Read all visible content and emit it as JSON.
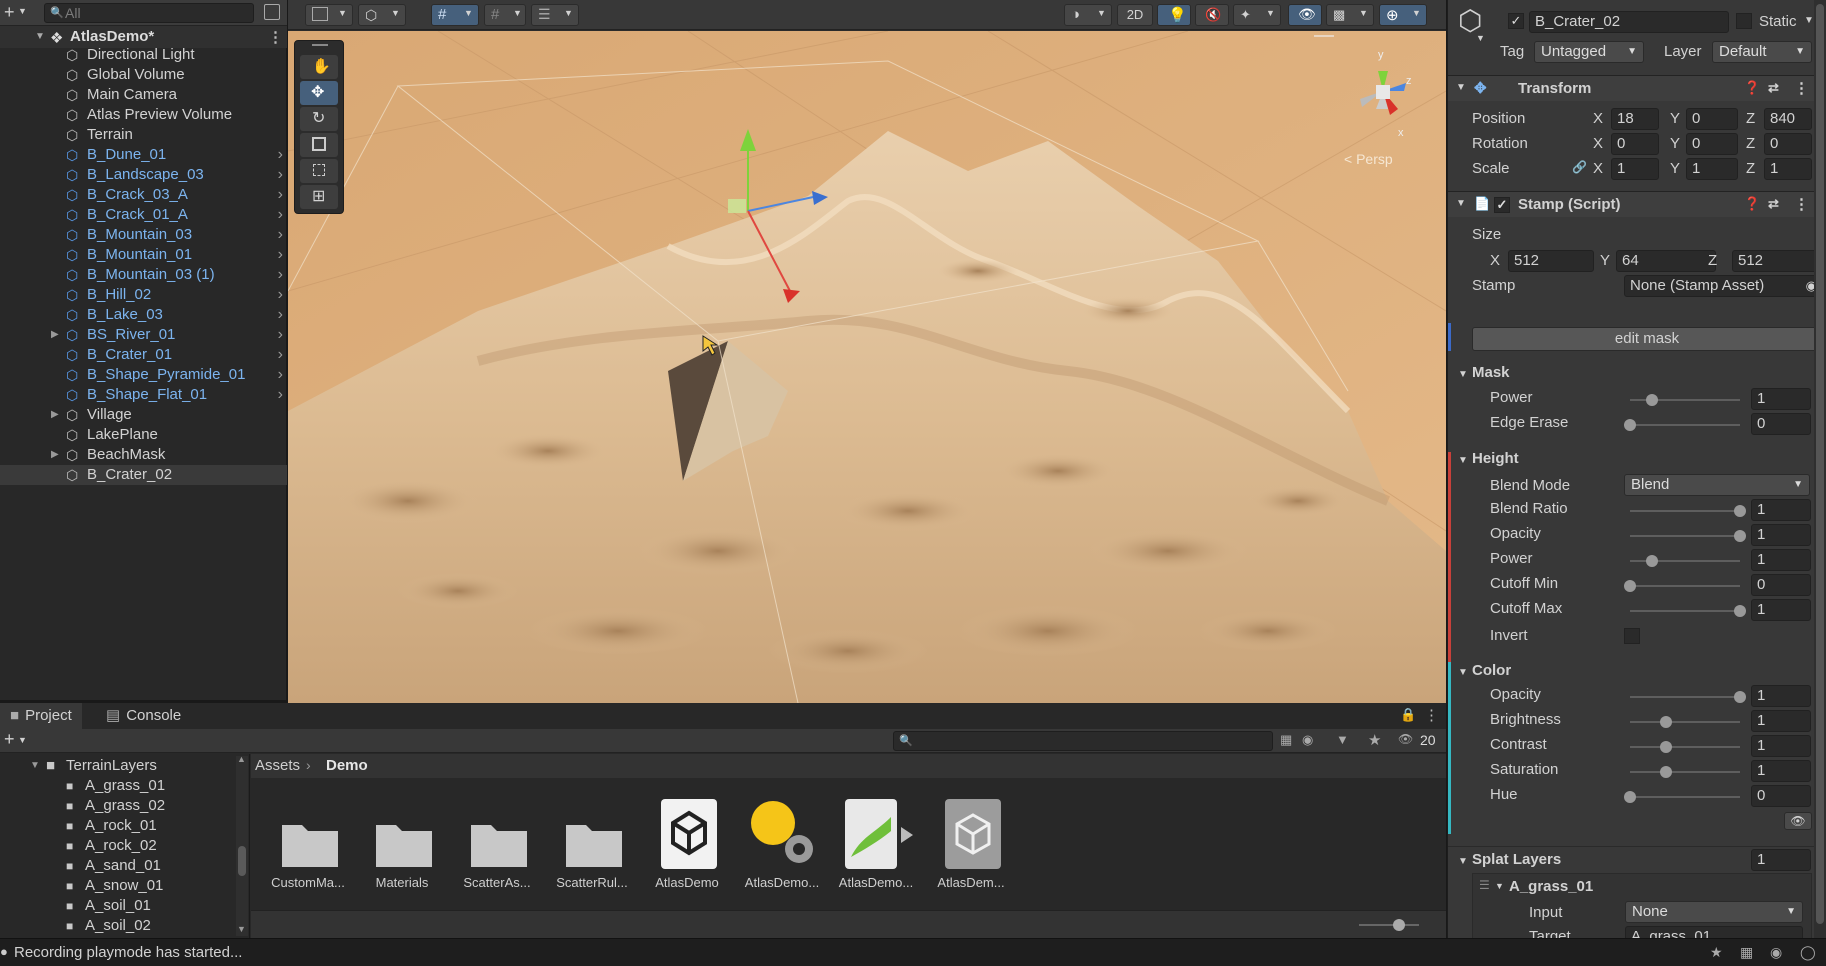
{
  "hierarchy": {
    "search_placeholder": "All",
    "scene_name": "AtlasDemo*",
    "items": [
      {
        "label": "Directional Light",
        "prefab": false,
        "expandable": false
      },
      {
        "label": "Global Volume",
        "prefab": false,
        "expandable": false
      },
      {
        "label": "Main Camera",
        "prefab": false,
        "expandable": false
      },
      {
        "label": "Atlas Preview Volume",
        "prefab": false,
        "expandable": false
      },
      {
        "label": "Terrain",
        "prefab": false,
        "expandable": false
      },
      {
        "label": "B_Dune_01",
        "prefab": true,
        "expandable": false
      },
      {
        "label": "B_Landscape_03",
        "prefab": true,
        "expandable": false
      },
      {
        "label": "B_Crack_03_A",
        "prefab": true,
        "expandable": false
      },
      {
        "label": "B_Crack_01_A",
        "prefab": true,
        "expandable": false
      },
      {
        "label": "B_Mountain_03",
        "prefab": true,
        "expandable": false
      },
      {
        "label": "B_Mountain_01",
        "prefab": true,
        "expandable": false
      },
      {
        "label": "B_Mountain_03 (1)",
        "prefab": true,
        "expandable": false
      },
      {
        "label": "B_Hill_02",
        "prefab": true,
        "expandable": false
      },
      {
        "label": "B_Lake_03",
        "prefab": true,
        "expandable": false
      },
      {
        "label": "BS_River_01",
        "prefab": true,
        "expandable": true
      },
      {
        "label": "B_Crater_01",
        "prefab": true,
        "expandable": false
      },
      {
        "label": "B_Shape_Pyramide_01",
        "prefab": true,
        "expandable": false
      },
      {
        "label": "B_Shape_Flat_01",
        "prefab": true,
        "expandable": false
      },
      {
        "label": "Village",
        "prefab": false,
        "expandable": true
      },
      {
        "label": "LakePlane",
        "prefab": false,
        "expandable": false
      },
      {
        "label": "BeachMask",
        "prefab": false,
        "expandable": true
      },
      {
        "label": "B_Crater_02",
        "prefab": false,
        "expandable": false,
        "selected": true
      }
    ]
  },
  "scene": {
    "toolbar": {
      "mode_2d": "2D"
    },
    "gizmo": {
      "persp_label": "< Persp",
      "axis_x": "x",
      "axis_y": "y",
      "axis_z": "z"
    }
  },
  "inspector": {
    "object_name": "B_Crater_02",
    "static_label": "Static",
    "tag_label": "Tag",
    "tag_value": "Untagged",
    "layer_label": "Layer",
    "layer_value": "Default",
    "transform": {
      "title": "Transform",
      "position_label": "Position",
      "rotation_label": "Rotation",
      "scale_label": "Scale",
      "position": {
        "x": "18",
        "y": "0",
        "z": "840"
      },
      "rotation": {
        "x": "0",
        "y": "0",
        "z": "0"
      },
      "scale": {
        "x": "1",
        "y": "1",
        "z": "1"
      }
    },
    "stamp": {
      "title": "Stamp (Script)",
      "size_label": "Size",
      "size": {
        "x": "512",
        "y": "64",
        "z": "512"
      },
      "stamp_label": "Stamp",
      "stamp_value": "None (Stamp Asset)",
      "edit_mask_label": "edit mask"
    },
    "mask": {
      "title": "Mask",
      "power_label": "Power",
      "power_value": "1",
      "power_level": 0.2,
      "edge_erase_label": "Edge Erase",
      "edge_erase_value": "0",
      "edge_erase_level": 0.0
    },
    "height": {
      "title": "Height",
      "blend_mode_label": "Blend Mode",
      "blend_mode_value": "Blend",
      "blend_ratio_label": "Blend Ratio",
      "blend_ratio_value": "1",
      "blend_ratio_level": 1.0,
      "opacity_label": "Opacity",
      "opacity_value": "1",
      "opacity_level": 1.0,
      "power_label": "Power",
      "power_value": "1",
      "power_level": 0.2,
      "cutoff_min_label": "Cutoff Min",
      "cutoff_min_value": "0",
      "cutoff_min_level": 0.0,
      "cutoff_max_label": "Cutoff Max",
      "cutoff_max_value": "1",
      "cutoff_max_level": 1.0,
      "invert_label": "Invert"
    },
    "color": {
      "title": "Color",
      "opacity_label": "Opacity",
      "opacity_value": "1",
      "opacity_level": 1.0,
      "brightness_label": "Brightness",
      "brightness_value": "1",
      "brightness_level": 0.33,
      "contrast_label": "Contrast",
      "contrast_value": "1",
      "contrast_level": 0.33,
      "saturation_label": "Saturation",
      "saturation_value": "1",
      "saturation_level": 0.33,
      "hue_label": "Hue",
      "hue_value": "0",
      "hue_level": 0.0
    },
    "splat_layers": {
      "title": "Splat Layers",
      "count": "1",
      "layer_name": "A_grass_01",
      "input_label": "Input",
      "input_value": "None",
      "target_label": "Target",
      "target_value": "A_grass_01"
    }
  },
  "project": {
    "tab_project": "Project",
    "tab_console": "Console",
    "hidden_count": "20",
    "tree_root": "TerrainLayers",
    "tree_items": [
      "A_grass_01",
      "A_grass_02",
      "A_rock_01",
      "A_rock_02",
      "A_sand_01",
      "A_snow_01",
      "A_soil_01",
      "A_soil_02"
    ],
    "breadcrumb_root": "Assets",
    "breadcrumb_current": "Demo",
    "assets": [
      {
        "name": "CustomMa...",
        "kind": "folder"
      },
      {
        "name": "Materials",
        "kind": "folder"
      },
      {
        "name": "ScatterAs...",
        "kind": "folder"
      },
      {
        "name": "ScatterRul...",
        "kind": "folder"
      },
      {
        "name": "AtlasDemo",
        "kind": "unity-scene"
      },
      {
        "name": "AtlasDemo...",
        "kind": "lighting-settings"
      },
      {
        "name": "AtlasDemo...",
        "kind": "terrain-data"
      },
      {
        "name": "AtlasDem...",
        "kind": "prefab"
      }
    ]
  },
  "status": {
    "message": "Recording playmode has started..."
  }
}
